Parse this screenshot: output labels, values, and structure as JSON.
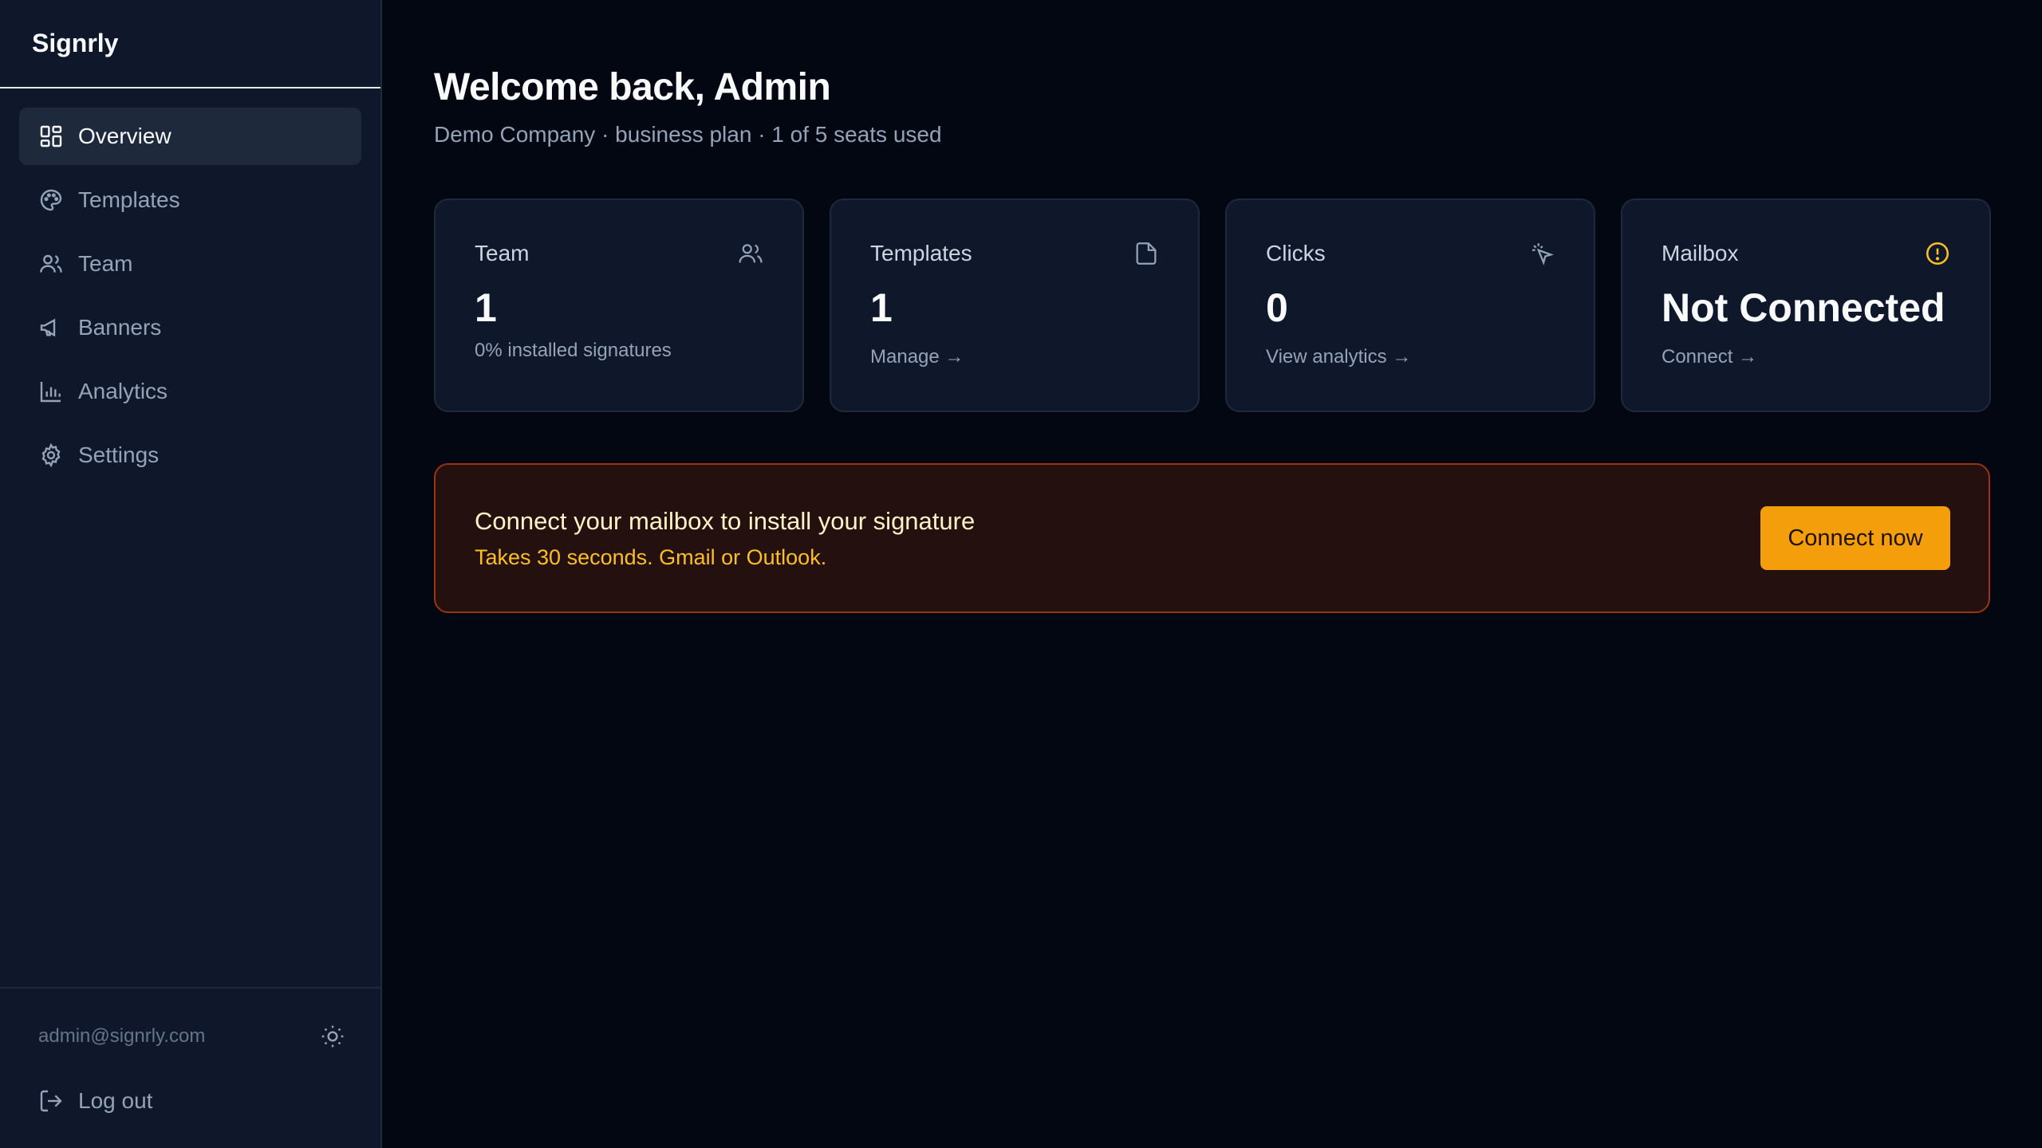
{
  "sidebar": {
    "brand": "Signrly",
    "items": [
      {
        "label": "Overview",
        "icon": "dashboard-icon"
      },
      {
        "label": "Templates",
        "icon": "palette-icon"
      },
      {
        "label": "Team",
        "icon": "users-icon"
      },
      {
        "label": "Banners",
        "icon": "megaphone-icon"
      },
      {
        "label": "Analytics",
        "icon": "bar-chart-icon"
      },
      {
        "label": "Settings",
        "icon": "gear-icon"
      }
    ],
    "active": "Overview",
    "email": "admin@signrly.com",
    "logout_label": "Log out"
  },
  "main": {
    "title": "Welcome back, Admin",
    "subtitle": "Demo Company · business plan · 1 of 5 seats used",
    "cards": [
      {
        "title": "Team",
        "value": "1",
        "sub": "0% installed signatures",
        "icon": "users-icon"
      },
      {
        "title": "Templates",
        "value": "1",
        "link": "Manage →",
        "icon": "file-icon"
      },
      {
        "title": "Clicks",
        "value": "0",
        "link": "View analytics →",
        "icon": "cursor-click-icon"
      },
      {
        "title": "Mailbox",
        "value": "Not Connected",
        "link": "Connect →",
        "icon": "alert-circle-icon"
      }
    ],
    "banner": {
      "title": "Connect your mailbox to install your signature",
      "subtitle": "Takes 30 seconds. Gmail or Outlook.",
      "button": "Connect now"
    }
  },
  "colors": {
    "background": "#030712",
    "sidebar": "#0f172a",
    "accent": "#f59e0b",
    "warning_text": "#fbbf24"
  }
}
